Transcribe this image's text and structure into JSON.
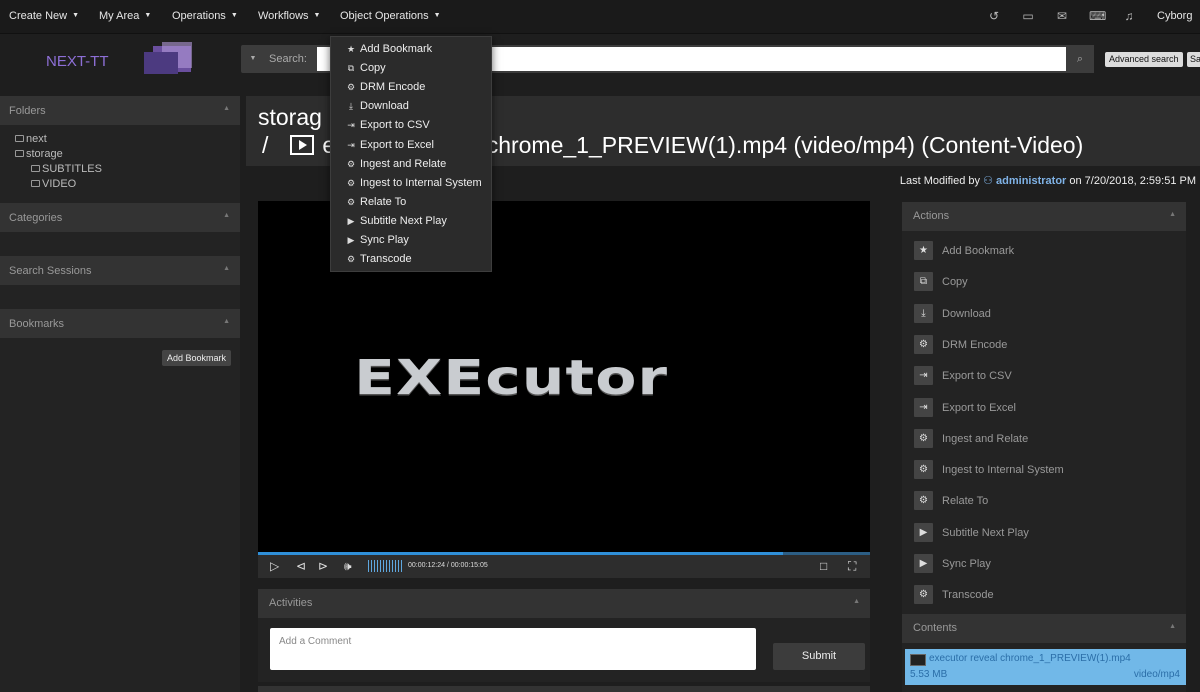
{
  "top_menu": {
    "items": [
      {
        "label": "Create New"
      },
      {
        "label": "My Area"
      },
      {
        "label": "Operations"
      },
      {
        "label": "Workflows"
      },
      {
        "label": "Object Operations"
      }
    ],
    "user": "Cyborg",
    "icons": [
      "history-icon",
      "chat-icon",
      "mail-icon",
      "keyboard-icon",
      "bell-icon"
    ]
  },
  "logo": {
    "text": "NEXT-TT"
  },
  "search": {
    "label": "Search:",
    "value": "",
    "advanced_label": "Advanced search",
    "save_label": "Save"
  },
  "sidebar": {
    "folders": {
      "title": "Folders",
      "items": [
        {
          "label": "next"
        },
        {
          "label": "storage"
        },
        {
          "label": "SUBTITLES"
        },
        {
          "label": "VIDEO"
        }
      ]
    },
    "categories": {
      "title": "Categories"
    },
    "search_sessions": {
      "title": "Search Sessions"
    },
    "bookmarks": {
      "title": "Bookmarks",
      "add_label": "Add Bookmark"
    }
  },
  "title": {
    "line1": "storag",
    "line2_prefix": "/",
    "line2_text": "e",
    "line2_tail": "l chrome_1_PREVIEW(1).mp4 (video/mp4)  (Content-Video)"
  },
  "last_modified": {
    "prefix": "Last Modified by",
    "user": "administrator",
    "suffix": "on 7/20/2018, 2:59:51 PM"
  },
  "video": {
    "logo_text": "EXEcutor",
    "current_time": "00:00:12:24",
    "duration": "00:00:15:05",
    "time_display": "00:00:12:24 / 00:00:15:05",
    "progress": 0.858
  },
  "activities": {
    "title": "Activities",
    "comment_placeholder": "Add a Comment",
    "submit_label": "Submit"
  },
  "actions": {
    "title": "Actions",
    "items": [
      {
        "label": "Add Bookmark",
        "icon": "star-icon",
        "glyph": "★"
      },
      {
        "label": "Copy",
        "icon": "copy-icon",
        "glyph": "⧉"
      },
      {
        "label": "Download",
        "icon": "download-icon",
        "glyph": "⤓"
      },
      {
        "label": "DRM Encode",
        "icon": "gears-icon",
        "glyph": "⚙"
      },
      {
        "label": "Export to CSV",
        "icon": "export-icon",
        "glyph": "⇥"
      },
      {
        "label": "Export to Excel",
        "icon": "export-icon",
        "glyph": "⇥"
      },
      {
        "label": "Ingest and Relate",
        "icon": "gears-icon",
        "glyph": "⚙"
      },
      {
        "label": "Ingest to Internal System",
        "icon": "gears-icon",
        "glyph": "⚙"
      },
      {
        "label": "Relate To",
        "icon": "gears-icon",
        "glyph": "⚙"
      },
      {
        "label": "Subtitle Next Play",
        "icon": "play-icon",
        "glyph": "▶"
      },
      {
        "label": "Sync Play",
        "icon": "play-icon",
        "glyph": "▶"
      },
      {
        "label": "Transcode",
        "icon": "gears-icon",
        "glyph": "⚙"
      }
    ]
  },
  "contents": {
    "title": "Contents",
    "item": {
      "name": "executor reveal chrome_1_PREVIEW(1).mp4",
      "size": "5.53 MB",
      "type": "video/mp4"
    }
  },
  "dropdown": {
    "items": [
      {
        "label": "Add Bookmark",
        "icon": "star-icon",
        "glyph": "★"
      },
      {
        "label": "Copy",
        "icon": "copy-icon",
        "glyph": "⧉"
      },
      {
        "label": "DRM Encode",
        "icon": "gears-icon",
        "glyph": "⚙"
      },
      {
        "label": "Download",
        "icon": "download-icon",
        "glyph": "⤓"
      },
      {
        "label": "Export to CSV",
        "icon": "export-icon",
        "glyph": "⇥"
      },
      {
        "label": "Export to Excel",
        "icon": "export-icon",
        "glyph": "⇥"
      },
      {
        "label": "Ingest and Relate",
        "icon": "gears-icon",
        "glyph": "⚙"
      },
      {
        "label": "Ingest to Internal System",
        "icon": "gears-icon",
        "glyph": "⚙"
      },
      {
        "label": "Relate To",
        "icon": "gears-icon",
        "glyph": "⚙"
      },
      {
        "label": "Subtitle Next Play",
        "icon": "play-icon",
        "glyph": "▶"
      },
      {
        "label": "Sync Play",
        "icon": "play-icon",
        "glyph": "▶"
      },
      {
        "label": "Transcode",
        "icon": "gears-icon",
        "glyph": "⚙"
      }
    ]
  },
  "colors": {
    "accent": "#2f8fd8",
    "link": "#7fb2e6",
    "selected": "#71b8e8",
    "background": "#1e1e1e"
  }
}
